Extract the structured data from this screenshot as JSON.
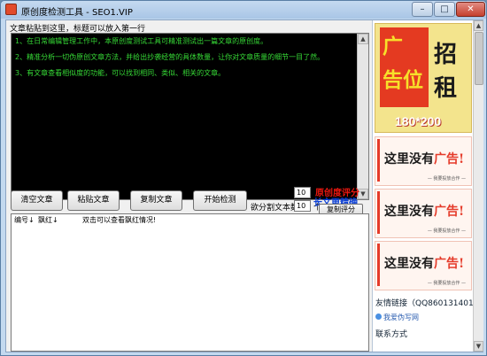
{
  "window": {
    "title": "原创度检测工具 - SEO1.VIP"
  },
  "window_controls": {
    "minimize": "–",
    "maximize": "□",
    "close": "✕"
  },
  "main": {
    "hint": "文章粘贴到这里，标题可以放入第一行",
    "editor_lines": [
      "1、在日常编辑管理工作中，本原创度测试工具可精准测试出一篇文章的原创度。",
      "2、精准分析一切伪原创文章方法，并给出抄袭经营的具体数量，让你对文章质量的细节一目了然。",
      "3、有文章查看相似度的功能，可以找到相同、类似、相关的文章。"
    ],
    "buttons": {
      "clear": "清空文章",
      "paste": "粘贴文章",
      "copy": "复制文章",
      "check": "开始检测",
      "copy_score": "复制评分"
    },
    "options": {
      "flag_label": "检测飘红字数：",
      "flag_value": "10",
      "flag_unit": "个",
      "split_label": "欲分割文本数：",
      "split_value": "10",
      "split_unit": "个"
    },
    "promo": {
      "line1": "原创度评分",
      "line2": "长文更精确"
    },
    "results": {
      "col_num": "编号↓",
      "col_red": "飘红↓",
      "col_hint": "双击可以查看飘红情况!"
    }
  },
  "sidebar": {
    "ad_top": {
      "t1": "广",
      "t2": "告位",
      "t3": "招",
      "t4": "租",
      "dims": "180*200"
    },
    "ad_cards": [
      {
        "slogan_pre": "这里没有",
        "slogan_red": "广告!",
        "sub": "— 我要投放合作 —"
      },
      {
        "slogan_pre": "这里没有",
        "slogan_red": "广告!",
        "sub": "— 我要投放合作 —"
      },
      {
        "slogan_pre": "这里没有",
        "slogan_red": "广告!",
        "sub": "— 我要投放合作 —"
      }
    ],
    "links_title": "友情链接（QQ860131401）",
    "link1": "我爱伪写网",
    "contact": "联系方式"
  },
  "colors": {
    "editor_bg": "#000000",
    "editor_text": "#36d936",
    "promo_red": "#e8170f",
    "promo_blue": "#0b3fd6"
  }
}
